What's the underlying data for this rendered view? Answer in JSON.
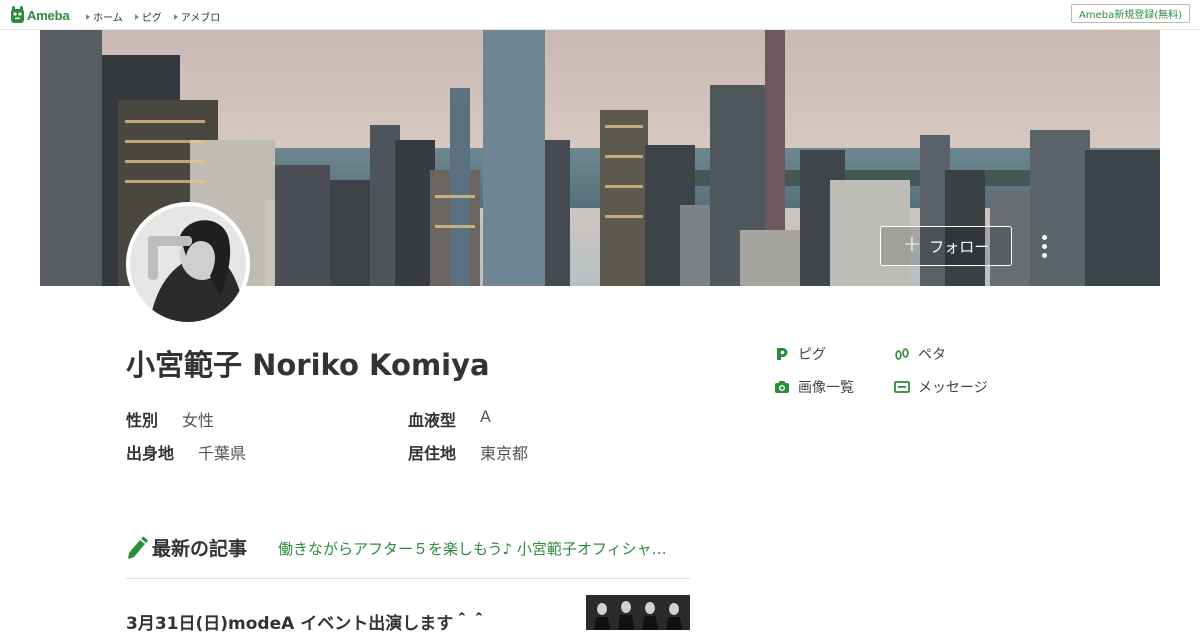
{
  "topbar": {
    "logo_text": "Ameba",
    "nav": [
      "ホーム",
      "ピグ",
      "アメブロ"
    ],
    "signup_label": "Ameba新規登録(無料)"
  },
  "cover": {
    "follow_label": "フォロー"
  },
  "profile": {
    "name": "小宮範子 Noriko Komiya",
    "fields": {
      "gender_label": "性別",
      "gender_value": "女性",
      "blood_label": "血液型",
      "blood_value": "A",
      "birthplace_label": "出身地",
      "birthplace_value": "千葉県",
      "residence_label": "居住地",
      "residence_value": "東京都"
    },
    "links": {
      "pigg": "ピグ",
      "peta": "ペタ",
      "images": "画像一覧",
      "message": "メッセージ"
    }
  },
  "latest": {
    "heading": "最新の記事",
    "blog_title": "働きながらアフター５を楽しもう♪ 小宮範子オフィシャ…",
    "entry_title": "3月31日(日)modeA イベント出演します＾＾"
  },
  "colors": {
    "brand_green": "#2d8c3c"
  }
}
